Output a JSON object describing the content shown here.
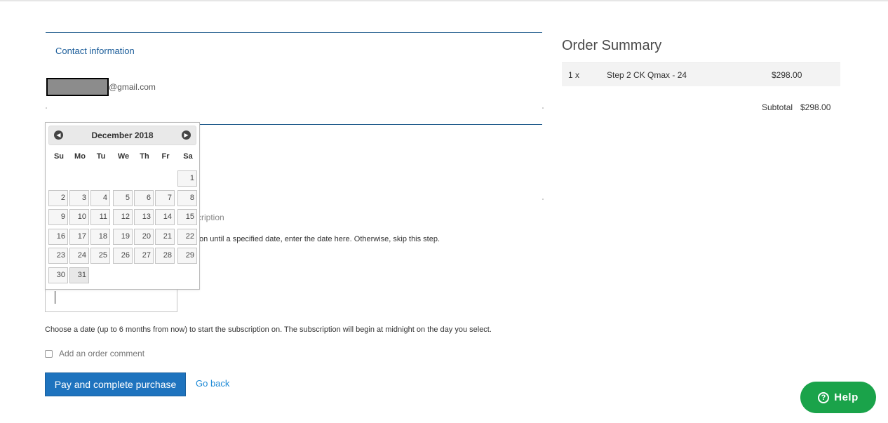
{
  "checkout": {
    "contact_title": "Contact information",
    "email_domain": "@gmail.com",
    "subscription_label": "cription",
    "subscription_help": "on until a specified date, enter the date here. Otherwise, skip this step.",
    "start_date_help": "Choose a date (up to 6 months from now) to start the subscription on. The subscription will begin at midnight on the day you select.",
    "comment_label": "Add an order comment",
    "comment_checked": false,
    "pay_button": "Pay and complete purchase",
    "go_back": "Go back"
  },
  "datepicker": {
    "month_title": "December 2018",
    "prev_icon": "arrow-left-icon",
    "next_icon": "arrow-right-icon",
    "weekdays": [
      "Su",
      "Mo",
      "Tu",
      "We",
      "Th",
      "Fr",
      "Sa"
    ],
    "first_weekday_index": 6,
    "days": [
      "1",
      "2",
      "3",
      "4",
      "5",
      "6",
      "7",
      "8",
      "9",
      "10",
      "11",
      "12",
      "13",
      "14",
      "15",
      "16",
      "17",
      "18",
      "19",
      "20",
      "21",
      "22",
      "23",
      "24",
      "25",
      "26",
      "27",
      "28",
      "29",
      "30",
      "31"
    ],
    "highlighted_day": "31"
  },
  "order_summary": {
    "title": "Order Summary",
    "items": [
      {
        "qty": "1 x",
        "name": "Step 2 CK Qmax - 24",
        "price": "$298.00"
      }
    ],
    "subtotal_label": "Subtotal",
    "subtotal_value": "$298.00"
  },
  "help": {
    "label": "Help",
    "icon": "question-icon"
  },
  "colors": {
    "primary_button": "#1e73be",
    "link": "#1e8ad6",
    "help_button": "#1aa34a",
    "section_rule": "#1f5b8c"
  }
}
